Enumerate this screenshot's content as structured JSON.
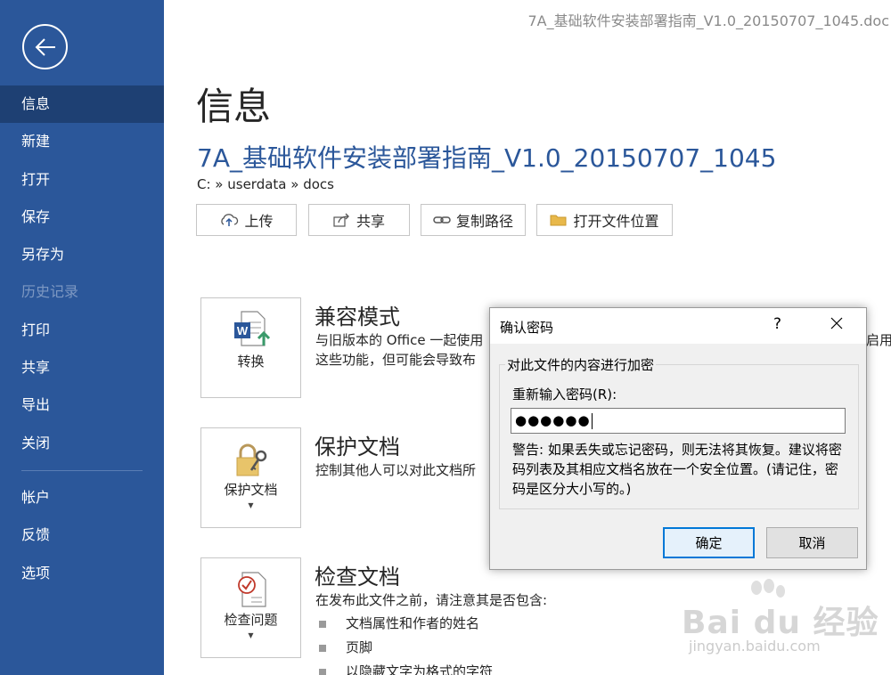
{
  "window": {
    "file_title": "7A_基础软件安装部署指南_V1.0_20150707_1045.doc"
  },
  "sidebar": {
    "back_icon": "back-arrow-icon",
    "items": [
      {
        "label": "信息",
        "state": "active"
      },
      {
        "label": "新建"
      },
      {
        "label": "打开"
      },
      {
        "label": "保存"
      },
      {
        "label": "另存为"
      },
      {
        "label": "历史记录",
        "state": "disabled"
      },
      {
        "label": "打印"
      },
      {
        "label": "共享"
      },
      {
        "label": "导出"
      },
      {
        "label": "关闭"
      }
    ],
    "bottom_items": [
      {
        "label": "帐户"
      },
      {
        "label": "反馈"
      },
      {
        "label": "选项"
      }
    ]
  },
  "main": {
    "page_title": "信息",
    "doc_name": "7A_基础软件安装部署指南_V1.0_20150707_1045",
    "doc_path": "C: » userdata » docs",
    "actions": [
      {
        "label": "上传",
        "icon": "upload-icon"
      },
      {
        "label": "共享",
        "icon": "share-icon"
      },
      {
        "label": "复制路径",
        "icon": "link-icon"
      },
      {
        "label": "打开文件位置",
        "icon": "folder-icon"
      }
    ],
    "sections": [
      {
        "card_label": "转换",
        "icon": "word-convert-icon",
        "title": "兼容模式",
        "lines": [
          "与旧版本的 Office 一起使用",
          "这些功能，但可能会导致布"
        ],
        "right_cut": "启用"
      },
      {
        "card_label": "保护文档",
        "icon": "lock-key-icon",
        "title": "保护文档",
        "lines": [
          "控制其他人可以对此文档所"
        ]
      },
      {
        "card_label": "检查问题",
        "icon": "inspect-document-icon",
        "title": "检查文档",
        "lines": [
          "在发布此文件之前，请注意其是否包含:"
        ],
        "bullets": [
          "文档属性和作者的姓名",
          "页脚",
          "以隐藏文字为格式的字符"
        ]
      }
    ]
  },
  "dialog": {
    "title": "确认密码",
    "help": "?",
    "group_label": "对此文件的内容进行加密",
    "field_label": "重新输入密码(R):",
    "password_value": "●●●●●●",
    "warning": "警告: 如果丢失或忘记密码，则无法将其恢复。建议将密码列表及其相应文档名放在一个安全位置。(请记住，密码是区分大小写的。)",
    "ok_label": "确定",
    "cancel_label": "取消"
  },
  "watermark": {
    "main": "Bai du 经验",
    "sub": "jingyan.baidu.com"
  }
}
